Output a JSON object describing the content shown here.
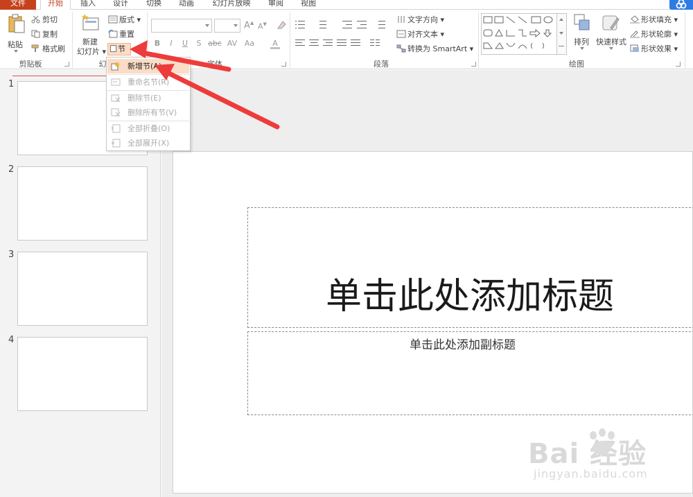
{
  "tabs": [
    {
      "label": "文件"
    },
    {
      "label": "开始"
    },
    {
      "label": "插入"
    },
    {
      "label": "设计"
    },
    {
      "label": "切换"
    },
    {
      "label": "动画"
    },
    {
      "label": "幻灯片放映"
    },
    {
      "label": "审阅"
    },
    {
      "label": "视图"
    }
  ],
  "ribbon": {
    "clipboard": {
      "paste": "粘贴",
      "cut": "剪切",
      "copy": "复制",
      "format_painter": "格式刷",
      "group_label": "剪贴板"
    },
    "slides": {
      "new_slide_line1": "新建",
      "new_slide_line2": "幻灯片",
      "layout": "版式",
      "reset": "重置",
      "section": "节",
      "group_label": "幻"
    },
    "font": {
      "bold": "B",
      "italic": "I",
      "underline": "U",
      "shadow": "S",
      "strikethrough": "abc",
      "spacing": "AV",
      "change_case": "Aa",
      "font_color": "A",
      "grow_font": "A",
      "shrink_font": "A",
      "group_label": "字体"
    },
    "paragraph": {
      "text_direction": "文字方向",
      "align_text": "对齐文本",
      "convert_smartart": "转换为 SmartArt",
      "group_label": "段落"
    },
    "drawing": {
      "arrange": "排列",
      "quick_styles": "快速样式",
      "shape_fill": "形状填充",
      "shape_outline": "形状轮廓",
      "shape_effects": "形状效果",
      "group_label": "绘图"
    }
  },
  "section_menu": {
    "items": [
      {
        "label": "新增节(A)",
        "enabled": true
      },
      {
        "label": "重命名节(R)",
        "enabled": false
      },
      {
        "label": "删除节(E)",
        "enabled": false
      },
      {
        "label": "删除所有节(V)",
        "enabled": false
      },
      {
        "label": "全部折叠(O)",
        "enabled": false
      },
      {
        "label": "全部展开(X)",
        "enabled": false
      }
    ]
  },
  "thumbnails": [
    {
      "number": "1"
    },
    {
      "number": "2"
    },
    {
      "number": "3"
    },
    {
      "number": "4"
    }
  ],
  "slide": {
    "title_placeholder": "单击此处添加标题",
    "subtitle_placeholder": "单击此处添加副标题"
  },
  "watermark": {
    "brand": "Bai 经验",
    "url": "jingyan.baidu.com"
  },
  "colors": {
    "file_tab": "#c6421c",
    "accent": "#c6421c",
    "highlight": "#fbdcc7",
    "arrow": "#ee3b3b"
  }
}
